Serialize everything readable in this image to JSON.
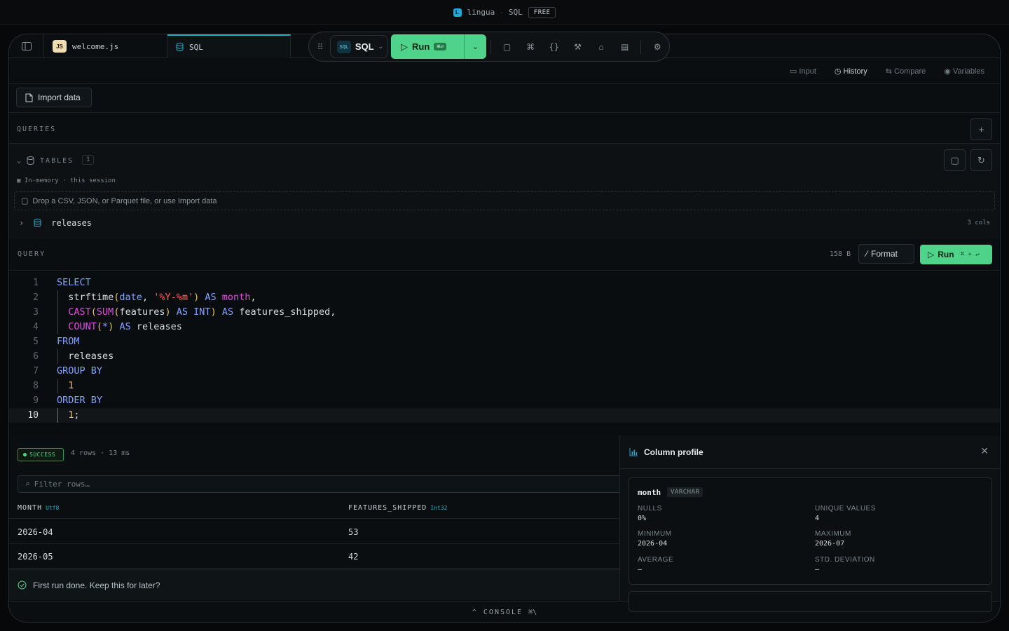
{
  "titlebar": {
    "app_name": "lingua",
    "separator": "·",
    "mode": "SQL",
    "plan_badge": "FREE",
    "logo_letter": "L"
  },
  "tabs": [
    {
      "label": "welcome.js",
      "icon": "JS"
    },
    {
      "label": "SQL",
      "icon": "database-icon"
    }
  ],
  "toolbar": {
    "language": "SQL",
    "language_chip": "SQL",
    "run_label": "Run",
    "run_shortcut": "⌘⏎"
  },
  "rightnav": {
    "input": "Input",
    "history": "History",
    "compare": "Compare",
    "variables": "Variables"
  },
  "import_label": "Import data",
  "queries_label": "QUERIES",
  "tables": {
    "label": "TABLES",
    "count": "1",
    "session_note": "In-memory · this session",
    "dropzone": "Drop a CSV, JSON, or Parquet file, or use Import data",
    "items": [
      {
        "name": "releases",
        "cols": "3 cols"
      }
    ]
  },
  "query": {
    "label": "QUERY",
    "size": "158 B",
    "format_label": "Format",
    "run_label": "Run",
    "run_shortcut": "⌘ + ↵"
  },
  "editor": {
    "lines": [
      "1",
      "2",
      "3",
      "4",
      "5",
      "6",
      "7",
      "8",
      "9",
      "10"
    ]
  },
  "results": {
    "status": "SUCCESS",
    "meta": "4 rows · 13 ms",
    "filter_placeholder": "Filter rows…",
    "columns": [
      {
        "name": "MONTH",
        "type": "Utf8"
      },
      {
        "name": "FEATURES_SHIPPED",
        "type": "Int32"
      }
    ],
    "rows": [
      [
        "2026-04",
        "53"
      ],
      [
        "2026-05",
        "42"
      ]
    ],
    "toast": "First run done. Keep this for later?"
  },
  "profile": {
    "title": "Column profile",
    "column": "month",
    "column_type": "VARCHAR",
    "stats": [
      {
        "label": "NULLS",
        "value": "0%"
      },
      {
        "label": "UNIQUE VALUES",
        "value": "4"
      },
      {
        "label": "MINIMUM",
        "value": "2026-04"
      },
      {
        "label": "MAXIMUM",
        "value": "2026-07"
      },
      {
        "label": "AVERAGE",
        "value": "—"
      },
      {
        "label": "STD. DEVIATION",
        "value": "—"
      }
    ]
  },
  "console": {
    "label": "CONSOLE",
    "shortcut": "⌘\\"
  }
}
